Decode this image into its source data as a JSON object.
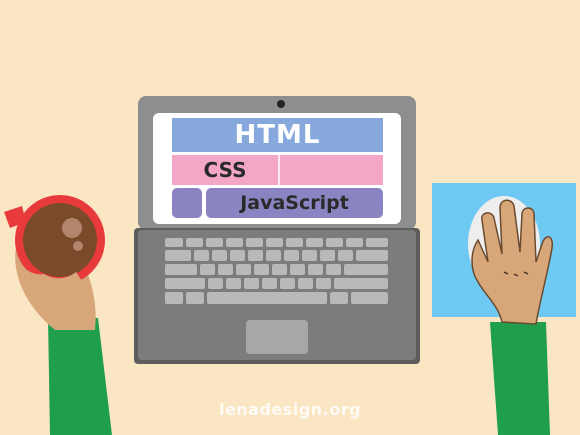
{
  "screen": {
    "html_label": "HTML",
    "css_label": "CSS",
    "js_label": "JavaScript"
  },
  "watermark": "lenadesign.org",
  "colors": {
    "background": "#fbe6c4",
    "laptop_body": "#8e8e8e",
    "screen": "#ffffff",
    "html_block": "#86a8dd",
    "css_block": "#f4a6c6",
    "js_block": "#8a85c2",
    "mousepad": "#6fcaf3",
    "sleeve": "#1f9e4c",
    "skin": "#d7a77a",
    "mug": "#e83a3a",
    "coffee": "#7a4a2b"
  },
  "icons": [
    "coffee-mug-icon",
    "computer-mouse-icon",
    "laptop-icon"
  ]
}
